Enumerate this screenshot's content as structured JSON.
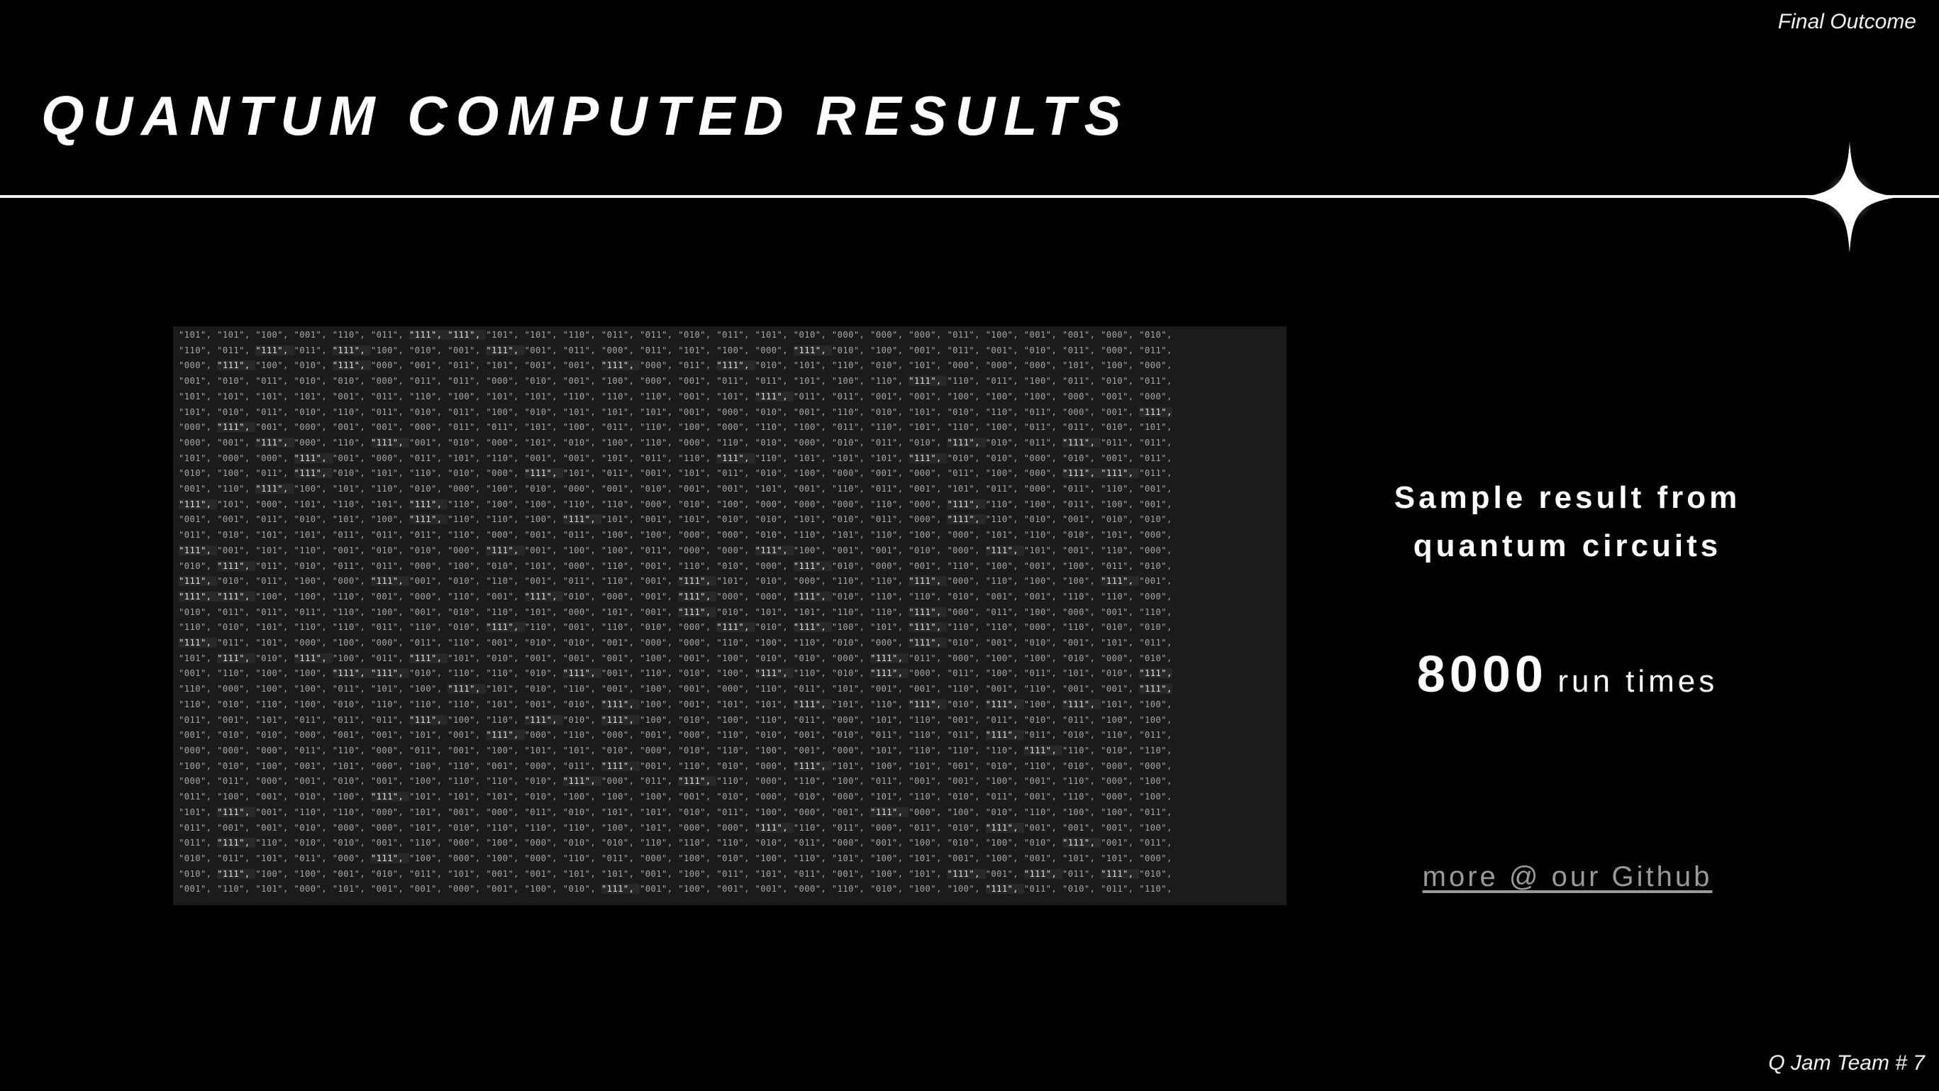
{
  "slide": {
    "header_label": "Final Outcome",
    "title": "QUANTUM COMPUTED RESULTS",
    "footer_label": "Q Jam Team # 7",
    "caption_line1": "Sample result from",
    "caption_line2": "quantum circuits",
    "run_count": "8000",
    "run_unit": "run times",
    "github_link": "more @ our Github"
  },
  "icons": {
    "divider_ornament": "four-point-sparkle-icon"
  },
  "sample_results_image": {
    "description_type": "screenshot-of-measurement-output",
    "rows": [
      [
        "101",
        "101",
        "100",
        "001",
        "110",
        "011",
        "111",
        "111",
        "101",
        "101",
        "110",
        "011",
        "011",
        "010",
        "011",
        "101",
        "010",
        "000",
        "000",
        "000",
        "011",
        "100",
        "001",
        "001",
        "000",
        "010"
      ],
      [
        "110",
        "011",
        "111",
        "011",
        "111",
        "100",
        "010",
        "001",
        "111",
        "001",
        "011",
        "000",
        "011",
        "101",
        "100",
        "000",
        "111",
        "010",
        "100",
        "001",
        "011",
        "001",
        "010",
        "011",
        "000",
        "011"
      ],
      [
        "000",
        "111",
        "100",
        "010",
        "111",
        "000",
        "001",
        "011",
        "101",
        "001",
        "001",
        "111",
        "000",
        "011",
        "111",
        "010",
        "101",
        "110",
        "010",
        "101",
        "000",
        "000",
        "000",
        "101",
        "100",
        "000"
      ],
      [
        "001",
        "010",
        "011",
        "010",
        "010",
        "000",
        "011",
        "011",
        "000",
        "010",
        "001",
        "100",
        "000",
        "001",
        "011",
        "011",
        "101",
        "100",
        "110",
        "111",
        "110",
        "011",
        "100",
        "011",
        "010",
        "011"
      ],
      [
        "101",
        "101",
        "101",
        "101",
        "001",
        "011",
        "110",
        "100",
        "101",
        "101",
        "110",
        "110",
        "110",
        "001",
        "101",
        "111",
        "011",
        "011",
        "001",
        "001",
        "100",
        "100",
        "100",
        "000",
        "001",
        "000"
      ],
      [
        "101",
        "010",
        "011",
        "010",
        "110",
        "011",
        "010",
        "011",
        "100",
        "010",
        "101",
        "101",
        "101",
        "001",
        "000",
        "010",
        "001",
        "110",
        "010",
        "101",
        "010",
        "110",
        "011",
        "000",
        "001",
        "111"
      ],
      [
        "000",
        "111",
        "001",
        "000",
        "001",
        "001",
        "000",
        "011",
        "011",
        "101",
        "100",
        "011",
        "110",
        "100",
        "000",
        "110",
        "100",
        "011",
        "110",
        "101",
        "110",
        "100",
        "011",
        "011",
        "010",
        "101"
      ],
      [
        "000",
        "001",
        "111",
        "000",
        "110",
        "111",
        "001",
        "010",
        "000",
        "101",
        "010",
        "100",
        "110",
        "000",
        "110",
        "010",
        "000",
        "010",
        "011",
        "010",
        "111",
        "010",
        "011",
        "111",
        "011",
        "011"
      ],
      [
        "101",
        "000",
        "000",
        "111",
        "001",
        "000",
        "011",
        "101",
        "110",
        "001",
        "001",
        "101",
        "011",
        "110",
        "111",
        "110",
        "101",
        "101",
        "101",
        "111",
        "010",
        "010",
        "000",
        "010",
        "001",
        "011"
      ],
      [
        "010",
        "100",
        "011",
        "111",
        "010",
        "101",
        "110",
        "010",
        "000",
        "111",
        "101",
        "011",
        "001",
        "101",
        "011",
        "010",
        "100",
        "000",
        "001",
        "000",
        "011",
        "100",
        "000",
        "111",
        "111",
        "011"
      ],
      [
        "001",
        "110",
        "111",
        "100",
        "101",
        "110",
        "010",
        "000",
        "100",
        "010",
        "000",
        "001",
        "010",
        "001",
        "001",
        "101",
        "001",
        "110",
        "011",
        "001",
        "101",
        "011",
        "000",
        "011",
        "110",
        "001"
      ],
      [
        "111",
        "101",
        "000",
        "101",
        "110",
        "101",
        "111",
        "110",
        "100",
        "100",
        "110",
        "110",
        "000",
        "010",
        "100",
        "000",
        "000",
        "000",
        "110",
        "000",
        "111",
        "110",
        "100",
        "011",
        "100",
        "001"
      ],
      [
        "001",
        "001",
        "011",
        "010",
        "101",
        "100",
        "111",
        "110",
        "110",
        "100",
        "111",
        "101",
        "001",
        "101",
        "010",
        "010",
        "101",
        "010",
        "011",
        "000",
        "111",
        "110",
        "010",
        "001",
        "010",
        "010"
      ],
      [
        "011",
        "010",
        "101",
        "101",
        "011",
        "011",
        "011",
        "110",
        "000",
        "001",
        "011",
        "100",
        "100",
        "000",
        "000",
        "010",
        "110",
        "101",
        "110",
        "100",
        "000",
        "101",
        "110",
        "010",
        "101",
        "000"
      ],
      [
        "111",
        "001",
        "101",
        "110",
        "001",
        "010",
        "010",
        "000",
        "111",
        "001",
        "100",
        "100",
        "011",
        "000",
        "000",
        "111",
        "100",
        "001",
        "001",
        "010",
        "000",
        "111",
        "101",
        "001",
        "110",
        "000"
      ],
      [
        "010",
        "111",
        "011",
        "010",
        "011",
        "011",
        "000",
        "100",
        "010",
        "101",
        "000",
        "110",
        "001",
        "110",
        "010",
        "000",
        "111",
        "010",
        "000",
        "001",
        "110",
        "100",
        "001",
        "100",
        "011",
        "010"
      ],
      [
        "111",
        "010",
        "011",
        "100",
        "000",
        "111",
        "001",
        "010",
        "110",
        "001",
        "011",
        "110",
        "001",
        "111",
        "101",
        "010",
        "000",
        "110",
        "110",
        "111",
        "000",
        "110",
        "100",
        "100",
        "111",
        "001"
      ],
      [
        "111",
        "111",
        "100",
        "100",
        "110",
        "001",
        "000",
        "110",
        "001",
        "111",
        "010",
        "000",
        "001",
        "111",
        "000",
        "000",
        "111",
        "010",
        "110",
        "110",
        "010",
        "001",
        "001",
        "110",
        "110",
        "000"
      ],
      [
        "010",
        "011",
        "011",
        "011",
        "110",
        "100",
        "001",
        "010",
        "110",
        "101",
        "000",
        "101",
        "001",
        "111",
        "010",
        "101",
        "101",
        "110",
        "110",
        "111",
        "000",
        "011",
        "100",
        "000",
        "001",
        "110"
      ],
      [
        "110",
        "010",
        "101",
        "110",
        "110",
        "011",
        "110",
        "010",
        "111",
        "110",
        "001",
        "110",
        "010",
        "000",
        "111",
        "010",
        "111",
        "100",
        "101",
        "111",
        "110",
        "110",
        "000",
        "110",
        "010",
        "010"
      ],
      [
        "111",
        "011",
        "101",
        "000",
        "100",
        "000",
        "011",
        "110",
        "001",
        "010",
        "010",
        "001",
        "000",
        "000",
        "110",
        "100",
        "110",
        "010",
        "000",
        "111",
        "010",
        "001",
        "010",
        "001",
        "101",
        "011"
      ],
      [
        "101",
        "111",
        "010",
        "111",
        "100",
        "011",
        "111",
        "101",
        "010",
        "001",
        "001",
        "001",
        "100",
        "001",
        "100",
        "010",
        "010",
        "000",
        "111",
        "011",
        "000",
        "100",
        "100",
        "010",
        "000",
        "010"
      ],
      [
        "001",
        "110",
        "100",
        "100",
        "111",
        "111",
        "010",
        "110",
        "110",
        "010",
        "111",
        "001",
        "110",
        "010",
        "100",
        "111",
        "110",
        "010",
        "111",
        "000",
        "011",
        "100",
        "011",
        "101",
        "010",
        "111"
      ],
      [
        "110",
        "000",
        "100",
        "100",
        "011",
        "101",
        "100",
        "111",
        "101",
        "010",
        "110",
        "001",
        "100",
        "001",
        "000",
        "110",
        "011",
        "101",
        "001",
        "001",
        "110",
        "001",
        "110",
        "001",
        "001",
        "111"
      ],
      [
        "110",
        "010",
        "110",
        "100",
        "010",
        "110",
        "110",
        "110",
        "101",
        "001",
        "010",
        "111",
        "100",
        "001",
        "101",
        "101",
        "111",
        "101",
        "110",
        "111",
        "010",
        "111",
        "100",
        "111",
        "101",
        "100"
      ],
      [
        "011",
        "001",
        "101",
        "011",
        "011",
        "011",
        "111",
        "100",
        "110",
        "111",
        "010",
        "111",
        "100",
        "010",
        "100",
        "110",
        "011",
        "000",
        "101",
        "110",
        "001",
        "011",
        "010",
        "011",
        "100",
        "100"
      ],
      [
        "001",
        "010",
        "010",
        "000",
        "001",
        "001",
        "101",
        "001",
        "111",
        "000",
        "110",
        "000",
        "001",
        "000",
        "110",
        "010",
        "001",
        "010",
        "011",
        "110",
        "011",
        "111",
        "011",
        "010",
        "110",
        "011"
      ],
      [
        "000",
        "000",
        "000",
        "011",
        "110",
        "000",
        "011",
        "001",
        "100",
        "101",
        "101",
        "010",
        "000",
        "010",
        "110",
        "100",
        "001",
        "000",
        "101",
        "110",
        "110",
        "110",
        "111",
        "110",
        "010",
        "110"
      ],
      [
        "100",
        "010",
        "100",
        "001",
        "101",
        "000",
        "100",
        "110",
        "001",
        "000",
        "011",
        "111",
        "001",
        "110",
        "010",
        "000",
        "111",
        "101",
        "100",
        "101",
        "001",
        "010",
        "110",
        "010",
        "000",
        "000"
      ],
      [
        "000",
        "011",
        "000",
        "001",
        "010",
        "001",
        "100",
        "110",
        "110",
        "010",
        "111",
        "000",
        "011",
        "111",
        "110",
        "000",
        "110",
        "100",
        "011",
        "001",
        "001",
        "100",
        "001",
        "110",
        "000",
        "100"
      ],
      [
        "011",
        "100",
        "001",
        "010",
        "100",
        "111",
        "101",
        "101",
        "101",
        "010",
        "100",
        "100",
        "100",
        "001",
        "010",
        "000",
        "010",
        "000",
        "101",
        "110",
        "010",
        "011",
        "001",
        "110",
        "000",
        "100"
      ],
      [
        "101",
        "111",
        "001",
        "110",
        "110",
        "000",
        "101",
        "001",
        "000",
        "011",
        "010",
        "101",
        "101",
        "010",
        "011",
        "100",
        "000",
        "001",
        "111",
        "000",
        "100",
        "010",
        "110",
        "100",
        "100",
        "011"
      ],
      [
        "011",
        "001",
        "001",
        "010",
        "000",
        "000",
        "101",
        "010",
        "110",
        "110",
        "110",
        "100",
        "101",
        "000",
        "000",
        "111",
        "110",
        "011",
        "000",
        "011",
        "010",
        "111",
        "001",
        "001",
        "001",
        "100"
      ],
      [
        "011",
        "111",
        "110",
        "010",
        "010",
        "001",
        "110",
        "000",
        "100",
        "000",
        "010",
        "010",
        "110",
        "110",
        "110",
        "010",
        "011",
        "000",
        "001",
        "100",
        "010",
        "100",
        "010",
        "111",
        "001",
        "011"
      ],
      [
        "010",
        "011",
        "101",
        "011",
        "000",
        "111",
        "100",
        "000",
        "100",
        "000",
        "110",
        "011",
        "000",
        "100",
        "010",
        "100",
        "110",
        "101",
        "100",
        "101",
        "001",
        "100",
        "001",
        "101",
        "101",
        "000"
      ],
      [
        "010",
        "111",
        "100",
        "100",
        "001",
        "010",
        "011",
        "101",
        "001",
        "001",
        "101",
        "101",
        "001",
        "100",
        "011",
        "101",
        "011",
        "001",
        "100",
        "101",
        "111",
        "001",
        "111",
        "011",
        "111",
        "010"
      ],
      [
        "001",
        "110",
        "101",
        "000",
        "101",
        "001",
        "001",
        "000",
        "001",
        "100",
        "010",
        "111",
        "001",
        "100",
        "001",
        "001",
        "000",
        "110",
        "010",
        "100",
        "100",
        "111",
        "011",
        "010",
        "011",
        "110"
      ]
    ]
  }
}
